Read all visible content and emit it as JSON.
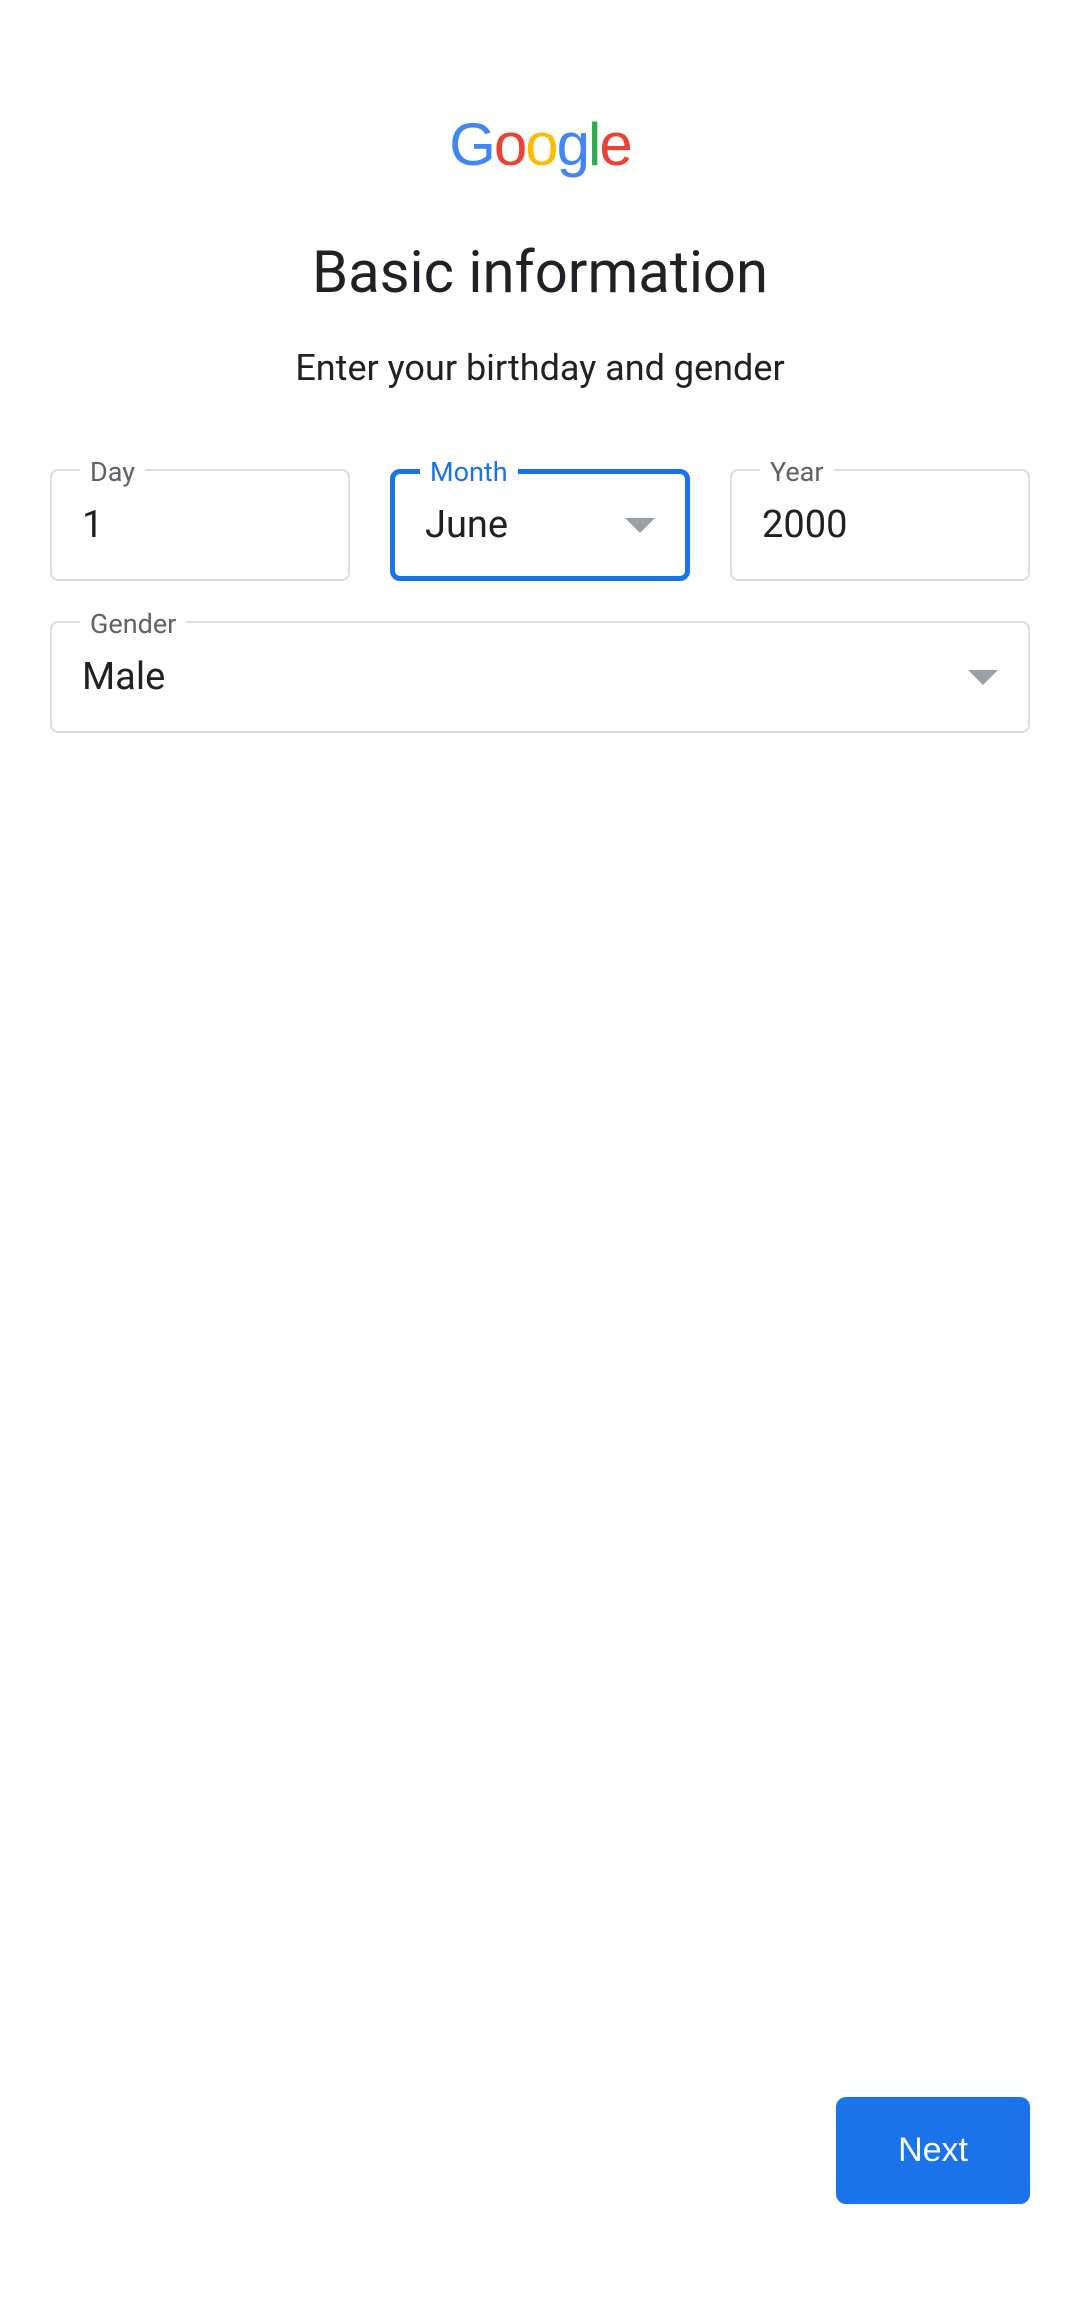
{
  "logo": {
    "g": "G",
    "o1": "o",
    "o2": "o",
    "g2": "g",
    "l": "l",
    "e": "e"
  },
  "heading": "Basic information",
  "subheading": "Enter your birthday and gender",
  "fields": {
    "day": {
      "label": "Day",
      "value": "1"
    },
    "month": {
      "label": "Month",
      "value": "June"
    },
    "year": {
      "label": "Year",
      "value": "2000"
    },
    "gender": {
      "label": "Gender",
      "value": "Male"
    }
  },
  "buttons": {
    "next": "Next"
  }
}
